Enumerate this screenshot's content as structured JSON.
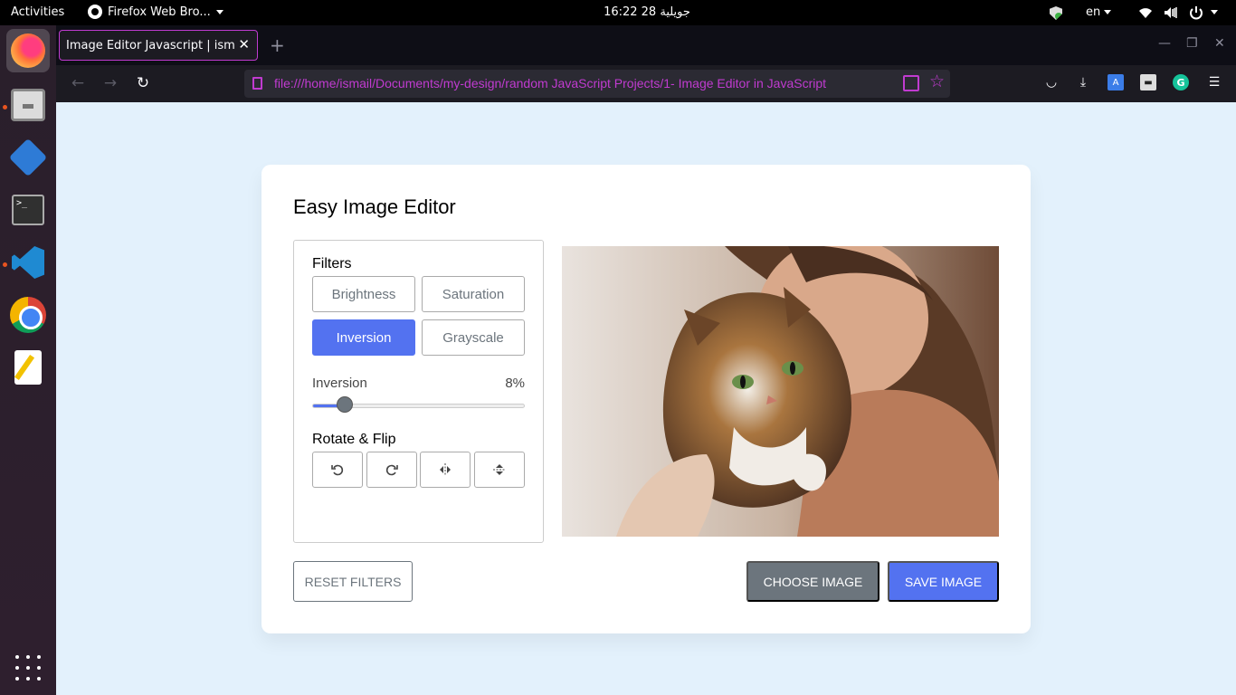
{
  "topbar": {
    "activities": "Activities",
    "app_name": "Firefox Web Bro...",
    "clock": "16:22  28 جويلية",
    "lang": "en"
  },
  "dock": {
    "apps": [
      "firefox-icon",
      "files-icon",
      "remmina-icon",
      "terminal-icon",
      "vscode-icon",
      "chrome-icon",
      "text-editor-icon"
    ]
  },
  "browser": {
    "tab_title": "Image Editor Javascript | ism",
    "url": "file:///home/ismail/Documents/my-design/random JavaScript Projects/1- Image Editor in JavaScript"
  },
  "editor": {
    "title": "Easy Image Editor",
    "filters_heading": "Filters",
    "filters": [
      {
        "label": "Brightness",
        "active": false
      },
      {
        "label": "Saturation",
        "active": false
      },
      {
        "label": "Inversion",
        "active": true
      },
      {
        "label": "Grayscale",
        "active": false
      }
    ],
    "slider": {
      "name": "Inversion",
      "value_text": "8%",
      "value": 8,
      "max": 100
    },
    "rotate_heading": "Rotate & Flip",
    "rotate_buttons": [
      "rotate-left-icon",
      "rotate-right-icon",
      "flip-horizontal-icon",
      "flip-vertical-icon"
    ],
    "reset_label": "RESET FILTERS",
    "choose_label": "CHOOSE IMAGE",
    "save_label": "SAVE IMAGE"
  },
  "colors": {
    "accent": "#5372f0",
    "secondary": "#6c757d",
    "page_bg": "#e3f1fc",
    "url_accent": "#c03bd0"
  }
}
